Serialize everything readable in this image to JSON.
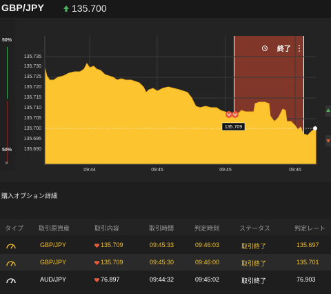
{
  "header": {
    "pair": "GBP/JPY",
    "price": "135.700"
  },
  "gauge": {
    "top_label": "50%",
    "bottom_label": "50%",
    "close_symbol": "×"
  },
  "chart": {
    "y_ticks": [
      "135.735",
      "135.730",
      "135.725",
      "135.720",
      "135.715",
      "135.710",
      "135.705",
      "135.700",
      "135.695",
      "135.690"
    ],
    "x_ticks": [
      "09:44",
      "09:45",
      "09:45",
      "09:46"
    ],
    "expired_label": "終了",
    "marker_value": "135.709",
    "colors": {
      "fill": "#fcc42e",
      "expired": "#8b3a2a",
      "background": "#232323"
    }
  },
  "section": {
    "title": "購入オプション詳細"
  },
  "table": {
    "headers": [
      "タイプ",
      "取引原資産",
      "取引内容",
      "取引時間",
      "判定時刻",
      "ステータス",
      "判定レート"
    ],
    "rows": [
      {
        "icon": "gauge-icon",
        "asset": "GBP/JPY",
        "content": "135.709",
        "time": "09:45:33",
        "judge": "09:46:03",
        "status": "取引終了",
        "rate": "135.697",
        "tone": "yellow"
      },
      {
        "icon": "gauge-icon",
        "asset": "GBP/JPY",
        "content": "135.709",
        "time": "09:45:30",
        "judge": "09:46:00",
        "status": "取引終了",
        "rate": "135.701",
        "tone": "yellow"
      },
      {
        "icon": "gauge-icon",
        "asset": "AUD/JPY",
        "content": "76.897",
        "time": "09:44:32",
        "judge": "09:45:02",
        "status": "取引終了",
        "rate": "76.903",
        "tone": "white"
      }
    ]
  }
}
